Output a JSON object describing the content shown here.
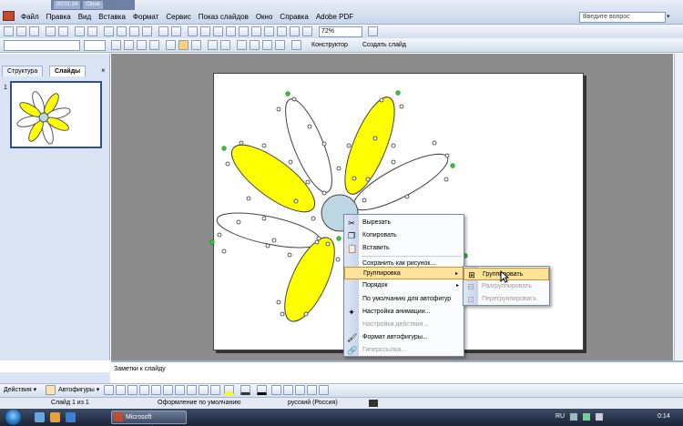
{
  "menubar": {
    "items": [
      "Файл",
      "Правка",
      "Вид",
      "Вставка",
      "Формат",
      "Сервис",
      "Показ слайдов",
      "Окно",
      "Справка",
      "Adobe PDF"
    ],
    "ghost_tabs": [
      "00:01:34",
      "Close"
    ],
    "help_placeholder": "Введите вопрос",
    "help_dropdown": "▾"
  },
  "toolbar1": {
    "zoom": "72%"
  },
  "toolbar2": {
    "font_name": "",
    "font_size": "",
    "designer_label": "Конструктор",
    "new_slide_label": "Создать слайд"
  },
  "left_pane": {
    "tabs": [
      "Структура",
      "Слайды"
    ],
    "close_glyph": "×",
    "slide_number": "1"
  },
  "notes": {
    "placeholder": "Заметки к слайду"
  },
  "drawbar": {
    "actions_label": "Действия ▾",
    "autoshapes_label": "Автофигуры ▾"
  },
  "status": {
    "slide": "Слайд 1 из 1",
    "design": "Оформление по умолчанию",
    "language": "русский (Россия)"
  },
  "taskbar": {
    "window_label": "Microsoft PowerPoi...",
    "lang": "RU",
    "clock": "0:14"
  },
  "context_menu": {
    "items": [
      {
        "label": "Вырезать",
        "icon": "scissors-icon",
        "disabled": false,
        "submenu": false
      },
      {
        "label": "Копировать",
        "icon": "copy-icon",
        "disabled": false,
        "submenu": false
      },
      {
        "label": "Вставить",
        "icon": "paste-icon",
        "disabled": false,
        "submenu": false
      },
      {
        "label": "Сохранить как рисунок...",
        "icon": "",
        "disabled": false,
        "submenu": false
      },
      {
        "label": "Группировка",
        "icon": "",
        "disabled": false,
        "submenu": true,
        "highlighted": true
      },
      {
        "label": "Порядок",
        "icon": "",
        "disabled": false,
        "submenu": true
      },
      {
        "label": "По умолчанию для автофигур",
        "icon": "",
        "disabled": false,
        "submenu": false
      },
      {
        "label": "Настройка анимации...",
        "icon": "animation-icon",
        "disabled": false,
        "submenu": false
      },
      {
        "label": "Настройка действия...",
        "icon": "",
        "disabled": true,
        "submenu": false
      },
      {
        "label": "Формат автофигуры...",
        "icon": "format-shape-icon",
        "disabled": false,
        "submenu": false
      },
      {
        "label": "Гиперссылка...",
        "icon": "hyperlink-icon",
        "disabled": true,
        "submenu": false
      }
    ],
    "submenu_arrow": "▸"
  },
  "group_submenu": {
    "items": [
      {
        "label": "Группировать",
        "icon": "group-icon",
        "disabled": false,
        "highlighted": true
      },
      {
        "label": "Разгруппировать",
        "icon": "ungroup-icon",
        "disabled": true
      },
      {
        "label": "Перегруппировать",
        "icon": "regroup-icon",
        "disabled": true
      }
    ]
  },
  "colors": {
    "petal_yellow": "#ffff00",
    "center_fill": "#bcd7e2",
    "handle_green": "#33cc33",
    "menu_highlight": "#ffe39a"
  }
}
